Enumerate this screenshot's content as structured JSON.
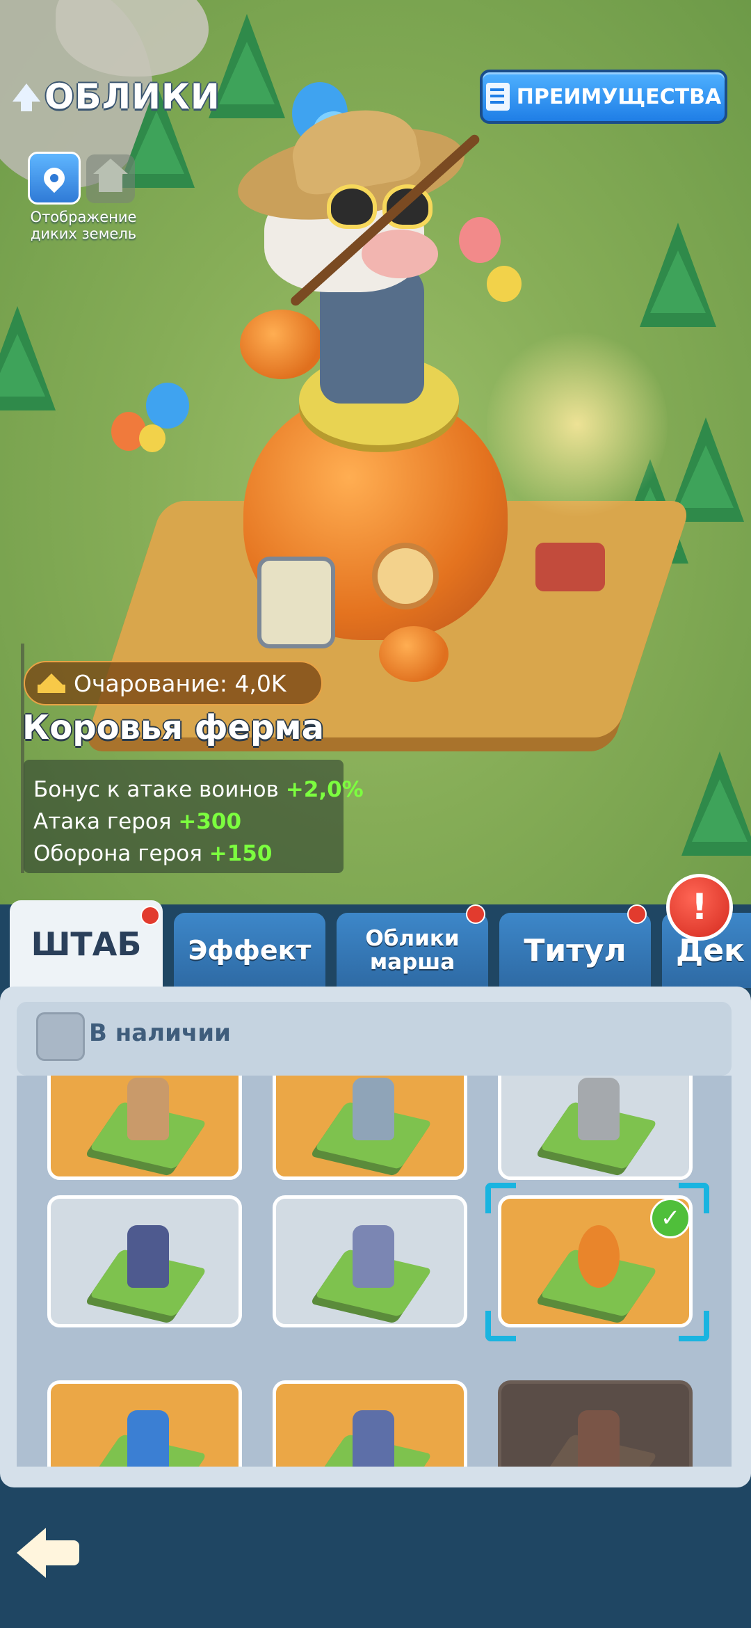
{
  "header": {
    "title": "ОБЛИКИ",
    "advantages_button": "ПРЕИМУЩЕСТВА"
  },
  "map_toggle": {
    "label": "Отображение диких земель"
  },
  "skin": {
    "charm_label": "Очарование: 4,0K",
    "name": "Коровья ферма",
    "bonuses": [
      {
        "label": "Бонус к атаке воинов",
        "value": "+2,0%"
      },
      {
        "label": "Атака героя",
        "value": "+300"
      },
      {
        "label": "Оборона героя",
        "value": "+150"
      }
    ]
  },
  "tabs": [
    {
      "label": "ШТАБ",
      "active": true,
      "badge": true
    },
    {
      "label": "Эффект",
      "active": false,
      "badge": false
    },
    {
      "label": "Облики марша",
      "active": false,
      "badge": true
    },
    {
      "label": "Титул",
      "active": false,
      "badge": true
    },
    {
      "label": "Дек",
      "active": false,
      "badge": false
    }
  ],
  "filter": {
    "label": "В наличии",
    "checked": false
  },
  "grid": {
    "items": [
      {
        "row": 1,
        "col": 1,
        "style": "orange",
        "owned": true
      },
      {
        "row": 1,
        "col": 2,
        "style": "orange",
        "owned": true
      },
      {
        "row": 1,
        "col": 3,
        "style": "grey",
        "owned": false
      },
      {
        "row": 2,
        "col": 1,
        "style": "grey",
        "owned": false
      },
      {
        "row": 2,
        "col": 2,
        "style": "grey",
        "owned": false
      },
      {
        "row": 2,
        "col": 3,
        "style": "orange",
        "owned": true,
        "selected": true,
        "equipped": true
      },
      {
        "row": 3,
        "col": 1,
        "style": "orange",
        "owned": true
      },
      {
        "row": 3,
        "col": 2,
        "style": "orange",
        "owned": true
      },
      {
        "row": 3,
        "col": 3,
        "style": "dark",
        "owned": false
      }
    ]
  },
  "colors": {
    "accent_blue": "#2f86e0",
    "bonus_green": "#7cff3f",
    "badge_red": "#e23b2e",
    "selection_cyan": "#19b4e0"
  },
  "icons": {
    "title": "up-arrow-icon",
    "advantages": "document-search-icon",
    "map": "map-pin-icon",
    "house": "house-icon",
    "charm": "crown-icon",
    "alert": "exclamation-icon",
    "equipped": "checkmark-icon",
    "back": "back-arrow-icon"
  }
}
